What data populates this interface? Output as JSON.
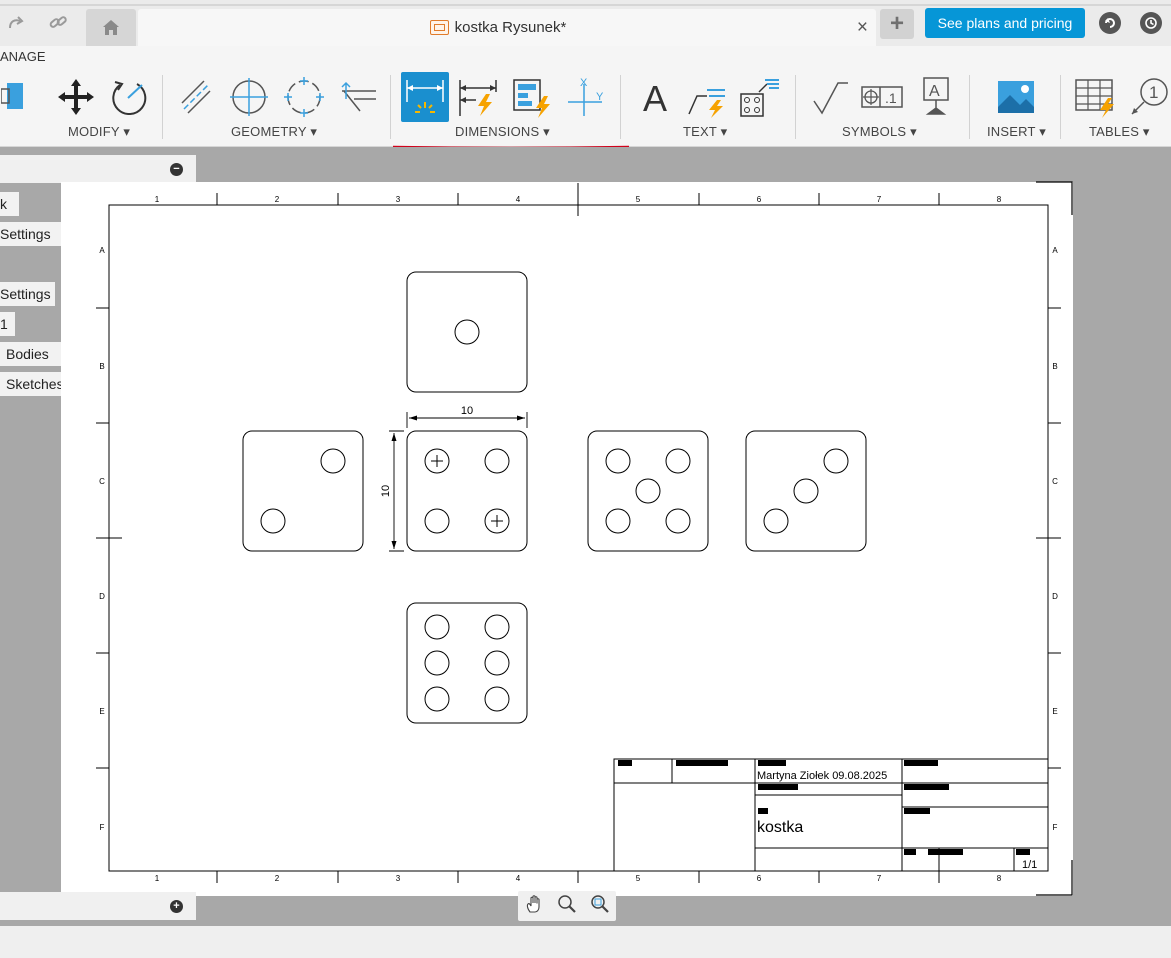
{
  "tab": {
    "title": "kostka Rysunek*",
    "close_glyph": "×",
    "new_tab_glyph": "+"
  },
  "top_actions": {
    "plans_label": "See plans and pricing",
    "icons": [
      "redo-icon",
      "link-icon",
      "home-icon",
      "job-status-icon",
      "clock-icon"
    ]
  },
  "ribbon": {
    "cut_label": "ANAGE",
    "groups": [
      {
        "label": "MODIFY ▾"
      },
      {
        "label": "GEOMETRY ▾"
      },
      {
        "label": "DIMENSIONS ▾"
      },
      {
        "label": "TEXT ▾"
      },
      {
        "label": "SYMBOLS ▾"
      },
      {
        "label": "INSERT ▾"
      },
      {
        "label": "TABLES ▾"
      }
    ],
    "accent": "#1a8fcf",
    "highlight": "#d0021b"
  },
  "browser": {
    "items": [
      {
        "label": "k"
      },
      {
        "label": "Settings"
      },
      {
        "label": "Settings"
      },
      {
        "label": "1"
      },
      {
        "label": "Bodies"
      },
      {
        "label": "Sketches"
      }
    ],
    "collapse_glyph": "−",
    "expand_glyph": "+"
  },
  "sheet": {
    "columns": [
      "1",
      "2",
      "3",
      "4",
      "5",
      "6",
      "7",
      "8"
    ],
    "rows": [
      "A",
      "B",
      "C",
      "D",
      "E",
      "F"
    ],
    "dimension_h": "10",
    "dimension_v": "10"
  },
  "title_block": {
    "author_date": "Martyna Ziołek  09.08.2025",
    "part_name": "kostka",
    "sheet_number": "1/1"
  },
  "nav_icons": [
    "pan-icon",
    "zoom-icon",
    "zoom-window-icon"
  ]
}
